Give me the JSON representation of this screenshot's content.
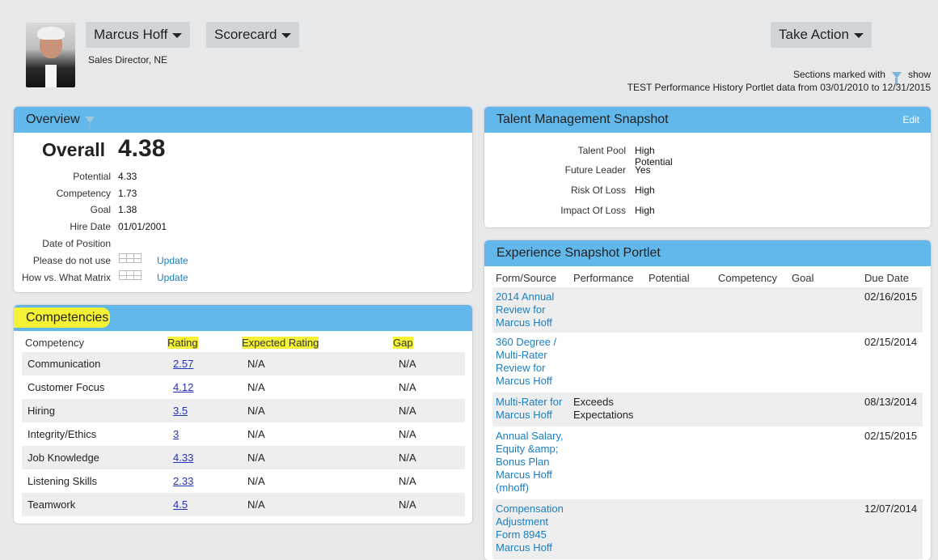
{
  "header": {
    "user_name": "Marcus Hoff",
    "view_label": "Scorecard",
    "action_label": "Take Action",
    "job_title": "Sales Director, NE",
    "note_line1_a": "Sections marked with",
    "note_line1_b": "show",
    "note_line2": "TEST Performance History Portlet data from 03/01/2010 to 12/31/2015"
  },
  "overview": {
    "title": "Overview",
    "overall_label": "Overall",
    "overall_value": "4.38",
    "rows": [
      {
        "label": "Potential",
        "value": "4.33"
      },
      {
        "label": "Competency",
        "value": "1.73"
      },
      {
        "label": "Goal",
        "value": "1.38"
      },
      {
        "label": "Hire Date",
        "value": "01/01/2001"
      },
      {
        "label": "Date of Position",
        "value": ""
      },
      {
        "label": "Please do not use",
        "link": "Update"
      },
      {
        "label": "How vs. What Matrix",
        "link": "Update"
      }
    ]
  },
  "competencies": {
    "title": "Competencies",
    "columns": [
      "Competency",
      "Rating",
      "Expected Rating",
      "Gap"
    ],
    "rows": [
      {
        "name": "Communication",
        "rating": "2.57",
        "expected": "N/A",
        "gap": "N/A"
      },
      {
        "name": "Customer Focus",
        "rating": "4.12",
        "expected": "N/A",
        "gap": "N/A"
      },
      {
        "name": "Hiring",
        "rating": "3.5",
        "expected": "N/A",
        "gap": "N/A"
      },
      {
        "name": "Integrity/Ethics",
        "rating": "3",
        "expected": "N/A",
        "gap": "N/A"
      },
      {
        "name": "Job Knowledge",
        "rating": "4.33",
        "expected": "N/A",
        "gap": "N/A"
      },
      {
        "name": "Listening Skills",
        "rating": "2.33",
        "expected": "N/A",
        "gap": "N/A"
      },
      {
        "name": "Teamwork",
        "rating": "4.5",
        "expected": "N/A",
        "gap": "N/A"
      }
    ],
    "highlight_color": "#f4f232"
  },
  "talent": {
    "title": "Talent Management Snapshot",
    "edit_label": "Edit",
    "rows": [
      {
        "label": "Talent Pool",
        "value": "High Potential"
      },
      {
        "label": "Future Leader",
        "value": "Yes"
      },
      {
        "label": "Risk Of Loss",
        "value": "High"
      },
      {
        "label": "Impact Of Loss",
        "value": "High"
      }
    ]
  },
  "experience": {
    "title": "Experience Snapshot Portlet",
    "columns": [
      "Form/Source",
      "Performance",
      "Potential",
      "Competency",
      "Goal",
      "Due Date"
    ],
    "rows": [
      {
        "form": "2014 Annual Review for Marcus Hoff",
        "performance": "",
        "potential": "",
        "competency": "",
        "goal": "",
        "due": "02/16/2015"
      },
      {
        "form": "360 Degree / Multi-Rater Review for Marcus Hoff",
        "performance": "",
        "potential": "",
        "competency": "",
        "goal": "",
        "due": "02/15/2014"
      },
      {
        "form": "Multi-Rater for Marcus Hoff",
        "performance": "Exceeds Expectations",
        "potential": "",
        "competency": "",
        "goal": "",
        "due": "08/13/2014"
      },
      {
        "form": "Annual Salary, Equity &amp; Bonus Plan Marcus Hoff (mhoff)",
        "performance": "",
        "potential": "",
        "competency": "",
        "goal": "",
        "due": "02/15/2015"
      },
      {
        "form": "Compensation Adjustment Form 8945 Marcus Hoff",
        "performance": "",
        "potential": "",
        "competency": "",
        "goal": "",
        "due": "12/07/2014"
      }
    ]
  },
  "colors": {
    "panel_header": "#62b8ea",
    "link": "#1a7fc0",
    "background": "#e6e8ea"
  }
}
